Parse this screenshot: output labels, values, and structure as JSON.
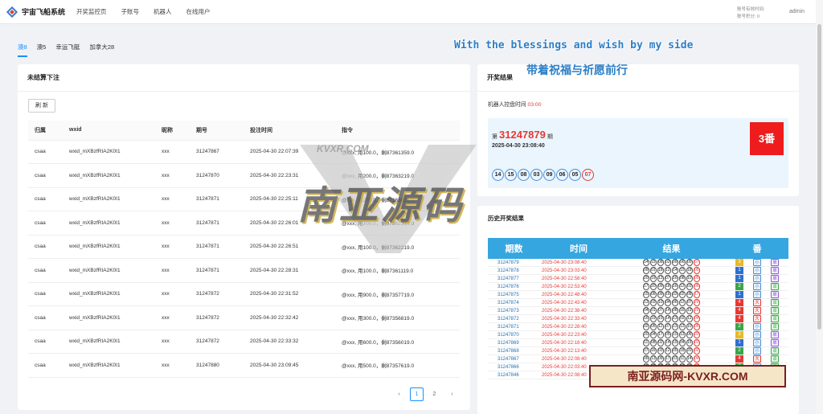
{
  "app": {
    "title": "宇宙飞船系统",
    "logo_icon": "diamond-logo-icon"
  },
  "nav": [
    "开奖监控页",
    "子账号",
    "机器人",
    "在线用户"
  ],
  "account": {
    "expire_label": "账号有效时间:",
    "points_label": "账号积分: 0",
    "username": "admin"
  },
  "tabs": [
    {
      "label": "澳8",
      "active": true
    },
    {
      "label": "澳5",
      "active": false
    },
    {
      "label": "幸运飞艇",
      "active": false
    },
    {
      "label": "加拿大28",
      "active": false
    }
  ],
  "unsettled": {
    "title": "未结算下注",
    "refresh_label": "刷 新",
    "columns": [
      "归属",
      "wxid",
      "昵称",
      "期号",
      "投注时间",
      "指令"
    ],
    "rows": [
      [
        "csaa",
        "wxid_mXBzfRIA2K0I1",
        "xxx",
        "31247867",
        "2025-04-30 22:07:39",
        "@xxx, 用100.0，剩87361359.0"
      ],
      [
        "csaa",
        "wxid_mXBzfRIA2K0I1",
        "xxx",
        "31247870",
        "2025-04-30 22:23:31",
        "@xxx, 用200.0，剩87363219.0"
      ],
      [
        "csaa",
        "wxid_mXBzfRIA2K0I1",
        "xxx",
        "31247871",
        "2025-04-30 22:25:11",
        "@xxx, 用200.0，剩87363019.0"
      ],
      [
        "csaa",
        "wxid_mXBzfRIA2K0I1",
        "xxx",
        "31247871",
        "2025-04-30 22:26:01",
        "@xxx, 用700.0，剩87362319.0"
      ],
      [
        "csaa",
        "wxid_mXBzfRIA2K0I1",
        "xxx",
        "31247871",
        "2025-04-30 22:26:51",
        "@xxx, 用100.0，剩87362219.0"
      ],
      [
        "csaa",
        "wxid_mXBzfRIA2K0I1",
        "xxx",
        "31247871",
        "2025-04-30 22:28:31",
        "@xxx, 用100.0，剩87361119.0"
      ],
      [
        "csaa",
        "wxid_mXBzfRIA2K0I1",
        "xxx",
        "31247872",
        "2025-04-30 22:31:52",
        "@xxx, 用900.0，剩87357719.0"
      ],
      [
        "csaa",
        "wxid_mXBzfRIA2K0I1",
        "xxx",
        "31247872",
        "2025-04-30 22:32:42",
        "@xxx, 用300.0，剩87356819.0"
      ],
      [
        "csaa",
        "wxid_mXBzfRIA2K0I1",
        "xxx",
        "31247872",
        "2025-04-30 22:33:32",
        "@xxx, 用600.0，剩87356019.0"
      ],
      [
        "csaa",
        "wxid_mXBzfRIA2K0I1",
        "xxx",
        "31247880",
        "2025-04-30 23:09:45",
        "@xxx, 用500.0，剩87357619.0"
      ]
    ],
    "pagination": {
      "prev": "‹",
      "pages": [
        "1",
        "2"
      ],
      "active": "1",
      "next": "›"
    }
  },
  "result": {
    "title": "开奖结果",
    "robot_label": "机器人控盘时间",
    "robot_time": "03:00",
    "period_prefix": "第",
    "period": "31247879",
    "period_suffix": "期",
    "time": "2025-04-30 23:08:40",
    "balls": [
      "14",
      "15",
      "08",
      "03",
      "09",
      "06",
      "05",
      "07"
    ],
    "fan": "3番"
  },
  "history": {
    "title": "历史开奖结果",
    "columns": [
      "期数",
      "时间",
      "结果",
      "番"
    ],
    "rows": [
      {
        "period": "31247879",
        "time": "2025-04-30 23:08:40",
        "balls": [
          "14",
          "15",
          "08",
          "03",
          "09",
          "06",
          "05",
          "07"
        ],
        "fan": "3",
        "size": "小",
        "parity": "单"
      },
      {
        "period": "31247878",
        "time": "2025-04-30 23:03:40",
        "balls": [
          "09",
          "01",
          "18",
          "12",
          "14",
          "15",
          "18",
          "05"
        ],
        "fan": "1",
        "size": "小",
        "parity": "单"
      },
      {
        "period": "31247877",
        "time": "2025-04-30 22:58:40",
        "balls": [
          "20",
          "19",
          "13",
          "07",
          "16",
          "08",
          "10",
          "05"
        ],
        "fan": "1",
        "size": "小",
        "parity": "单"
      },
      {
        "period": "31247876",
        "time": "2025-04-30 22:53:40",
        "balls": [
          "17",
          "20",
          "09",
          "18",
          "16",
          "12",
          "03",
          "06"
        ],
        "fan": "2",
        "size": "小",
        "parity": "双"
      },
      {
        "period": "31247875",
        "time": "2025-04-30 22:48:40",
        "balls": [
          "15",
          "06",
          "09",
          "16",
          "03",
          "02",
          "08",
          "17"
        ],
        "fan": "1",
        "size": "小",
        "parity": "单"
      },
      {
        "period": "31247874",
        "time": "2025-04-30 22:43:40",
        "balls": [
          "13",
          "03",
          "10",
          "04",
          "06",
          "12",
          "07",
          "20"
        ],
        "fan": "4",
        "size": "大",
        "parity": "双"
      },
      {
        "period": "31247873",
        "time": "2025-04-30 22:38:40",
        "balls": [
          "04",
          "01",
          "07",
          "14",
          "08",
          "16",
          "19",
          "20"
        ],
        "fan": "4",
        "size": "大",
        "parity": "双"
      },
      {
        "period": "31247872",
        "time": "2025-04-30 22:33:40",
        "balls": [
          "16",
          "19",
          "10",
          "14",
          "13",
          "02",
          "12",
          "04"
        ],
        "fan": "4",
        "size": "大",
        "parity": "双"
      },
      {
        "period": "31247871",
        "time": "2025-04-30 22:28:40",
        "balls": [
          "02",
          "05",
          "11",
          "07",
          "13",
          "12",
          "10",
          "06"
        ],
        "fan": "2",
        "size": "小",
        "parity": "双"
      },
      {
        "period": "31247870",
        "time": "2025-04-30 22:23:40",
        "balls": [
          "20",
          "04",
          "17",
          "05",
          "10",
          "13",
          "06",
          "03"
        ],
        "fan": "3",
        "size": "小",
        "parity": "单"
      },
      {
        "period": "31247869",
        "time": "2025-04-30 22:18:40",
        "balls": [
          "11",
          "08",
          "02",
          "14",
          "19",
          "04",
          "15",
          "01"
        ],
        "fan": "1",
        "size": "小",
        "parity": "单"
      },
      {
        "period": "31247868",
        "time": "2025-04-30 22:13:40",
        "balls": [
          "07",
          "16",
          "03",
          "12",
          "05",
          "18",
          "20",
          "02"
        ],
        "fan": "2",
        "size": "小",
        "parity": "双"
      },
      {
        "period": "31247867",
        "time": "2025-04-30 22:08:40",
        "balls": [
          "06",
          "13",
          "09",
          "17",
          "01",
          "11",
          "14",
          "04"
        ],
        "fan": "4",
        "size": "大",
        "parity": "双"
      },
      {
        "period": "31247866",
        "time": "2025-04-30 22:03:40",
        "balls": [
          "15",
          "02",
          "09",
          "19",
          "20",
          "16",
          "07",
          "06"
        ],
        "fan": "2",
        "size": "小",
        "parity": "双"
      },
      {
        "period": "31247846",
        "time": "2025-04-30 22:08:40",
        "balls": [
          "04",
          "16",
          "06",
          "12",
          "01",
          "02",
          "03",
          "20"
        ],
        "fan": "4",
        "size": "大",
        "parity": "双"
      }
    ]
  },
  "watermarks": {
    "en": "With the blessings and wish by my side",
    "cn": "带着祝福与祈愿前行",
    "site": "KVXR.COM",
    "big": "南亚源码",
    "banner": "南亚源码网-KVXR.COM"
  },
  "colors": {
    "accent": "#1890ff",
    "red": "#e53935",
    "header_blue": "#35a6e0",
    "fan_1": "#2f6fd0",
    "fan_2": "#3aa547",
    "fan_3": "#e8b923",
    "fan_4": "#e53935"
  }
}
